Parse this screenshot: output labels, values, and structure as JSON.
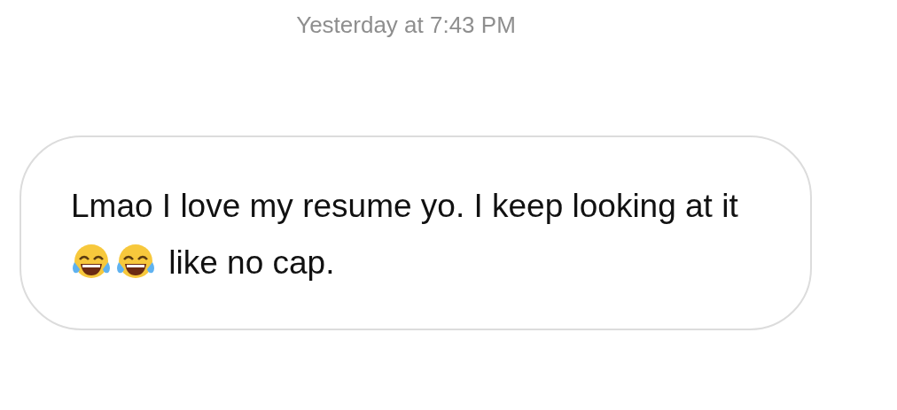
{
  "timestamp": "Yesterday at 7:43 PM",
  "message": {
    "text_before": "Lmao I love my resume yo. I keep looking at it",
    "emojis": [
      {
        "kind": "tears-of-joy"
      },
      {
        "kind": "tears-of-joy"
      }
    ],
    "text_after": "like no cap."
  }
}
